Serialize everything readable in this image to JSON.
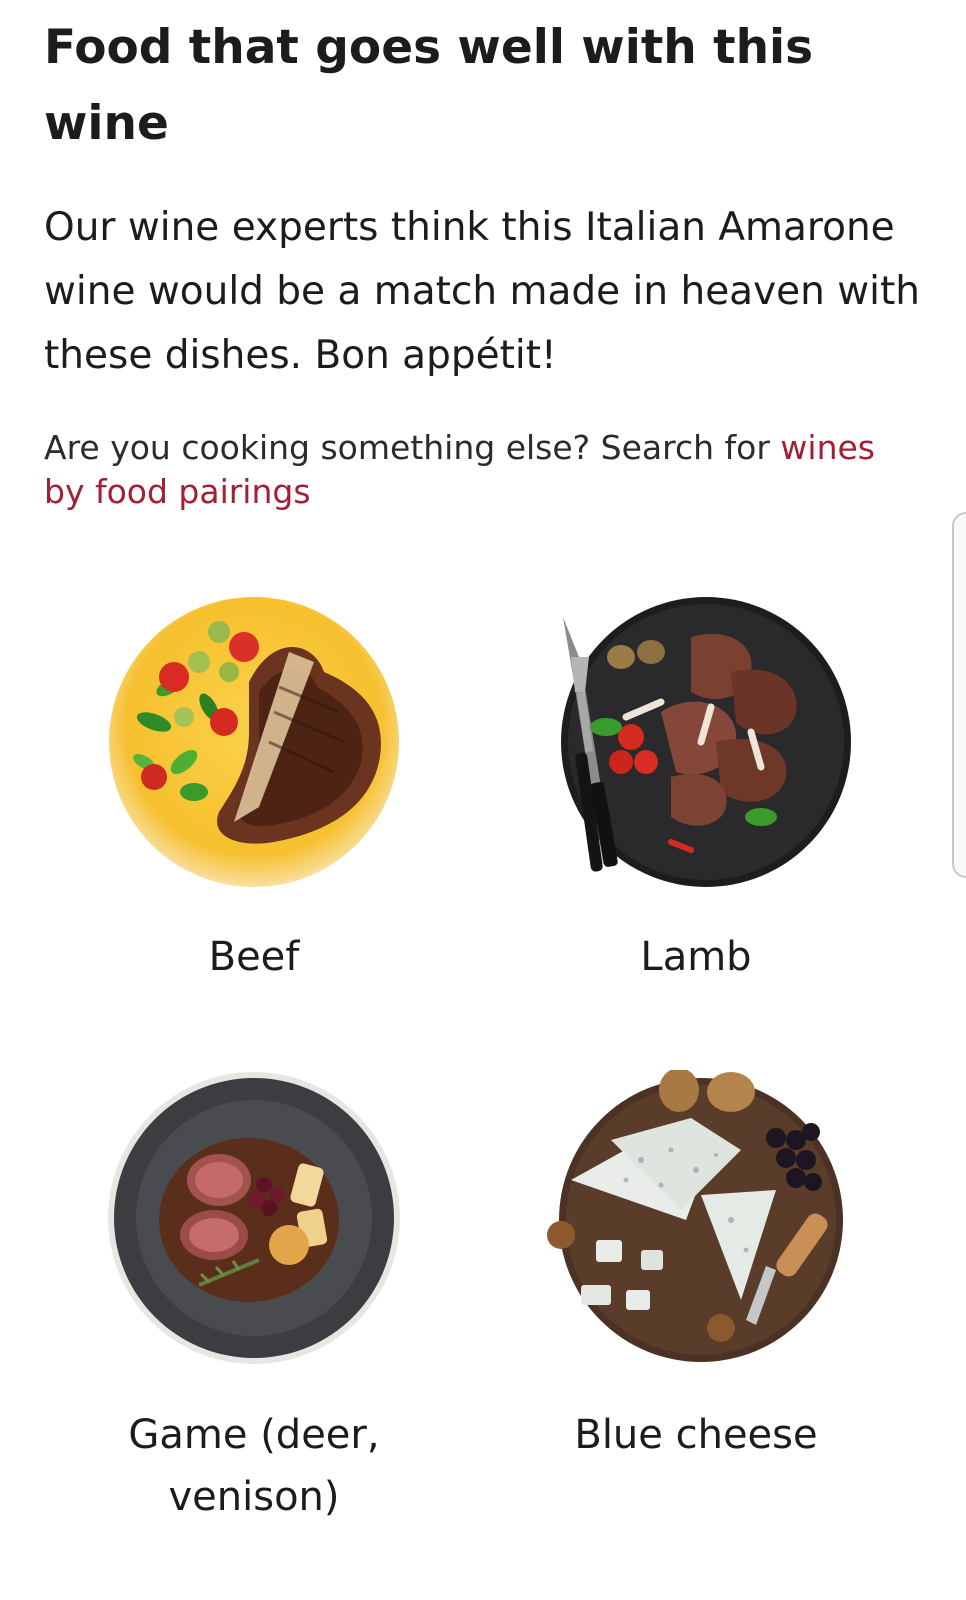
{
  "section": {
    "title": "Food that goes well with this wine",
    "intro": "Our wine experts think this Italian Amarone wine would be a match made in heaven with these dishes. Bon appétit!",
    "search_prefix": "Are you cooking something else? Search for ",
    "search_link": "wines by food pairings"
  },
  "pairings": [
    {
      "label": "Beef",
      "icon": "beef-dish-image"
    },
    {
      "label": "Lamb",
      "icon": "lamb-dish-image"
    },
    {
      "label": "Game (deer, venison)",
      "icon": "game-dish-image"
    },
    {
      "label": "Blue cheese",
      "icon": "blue-cheese-dish-image"
    }
  ],
  "colors": {
    "link": "#a41e34",
    "text": "#1c1c1c"
  }
}
